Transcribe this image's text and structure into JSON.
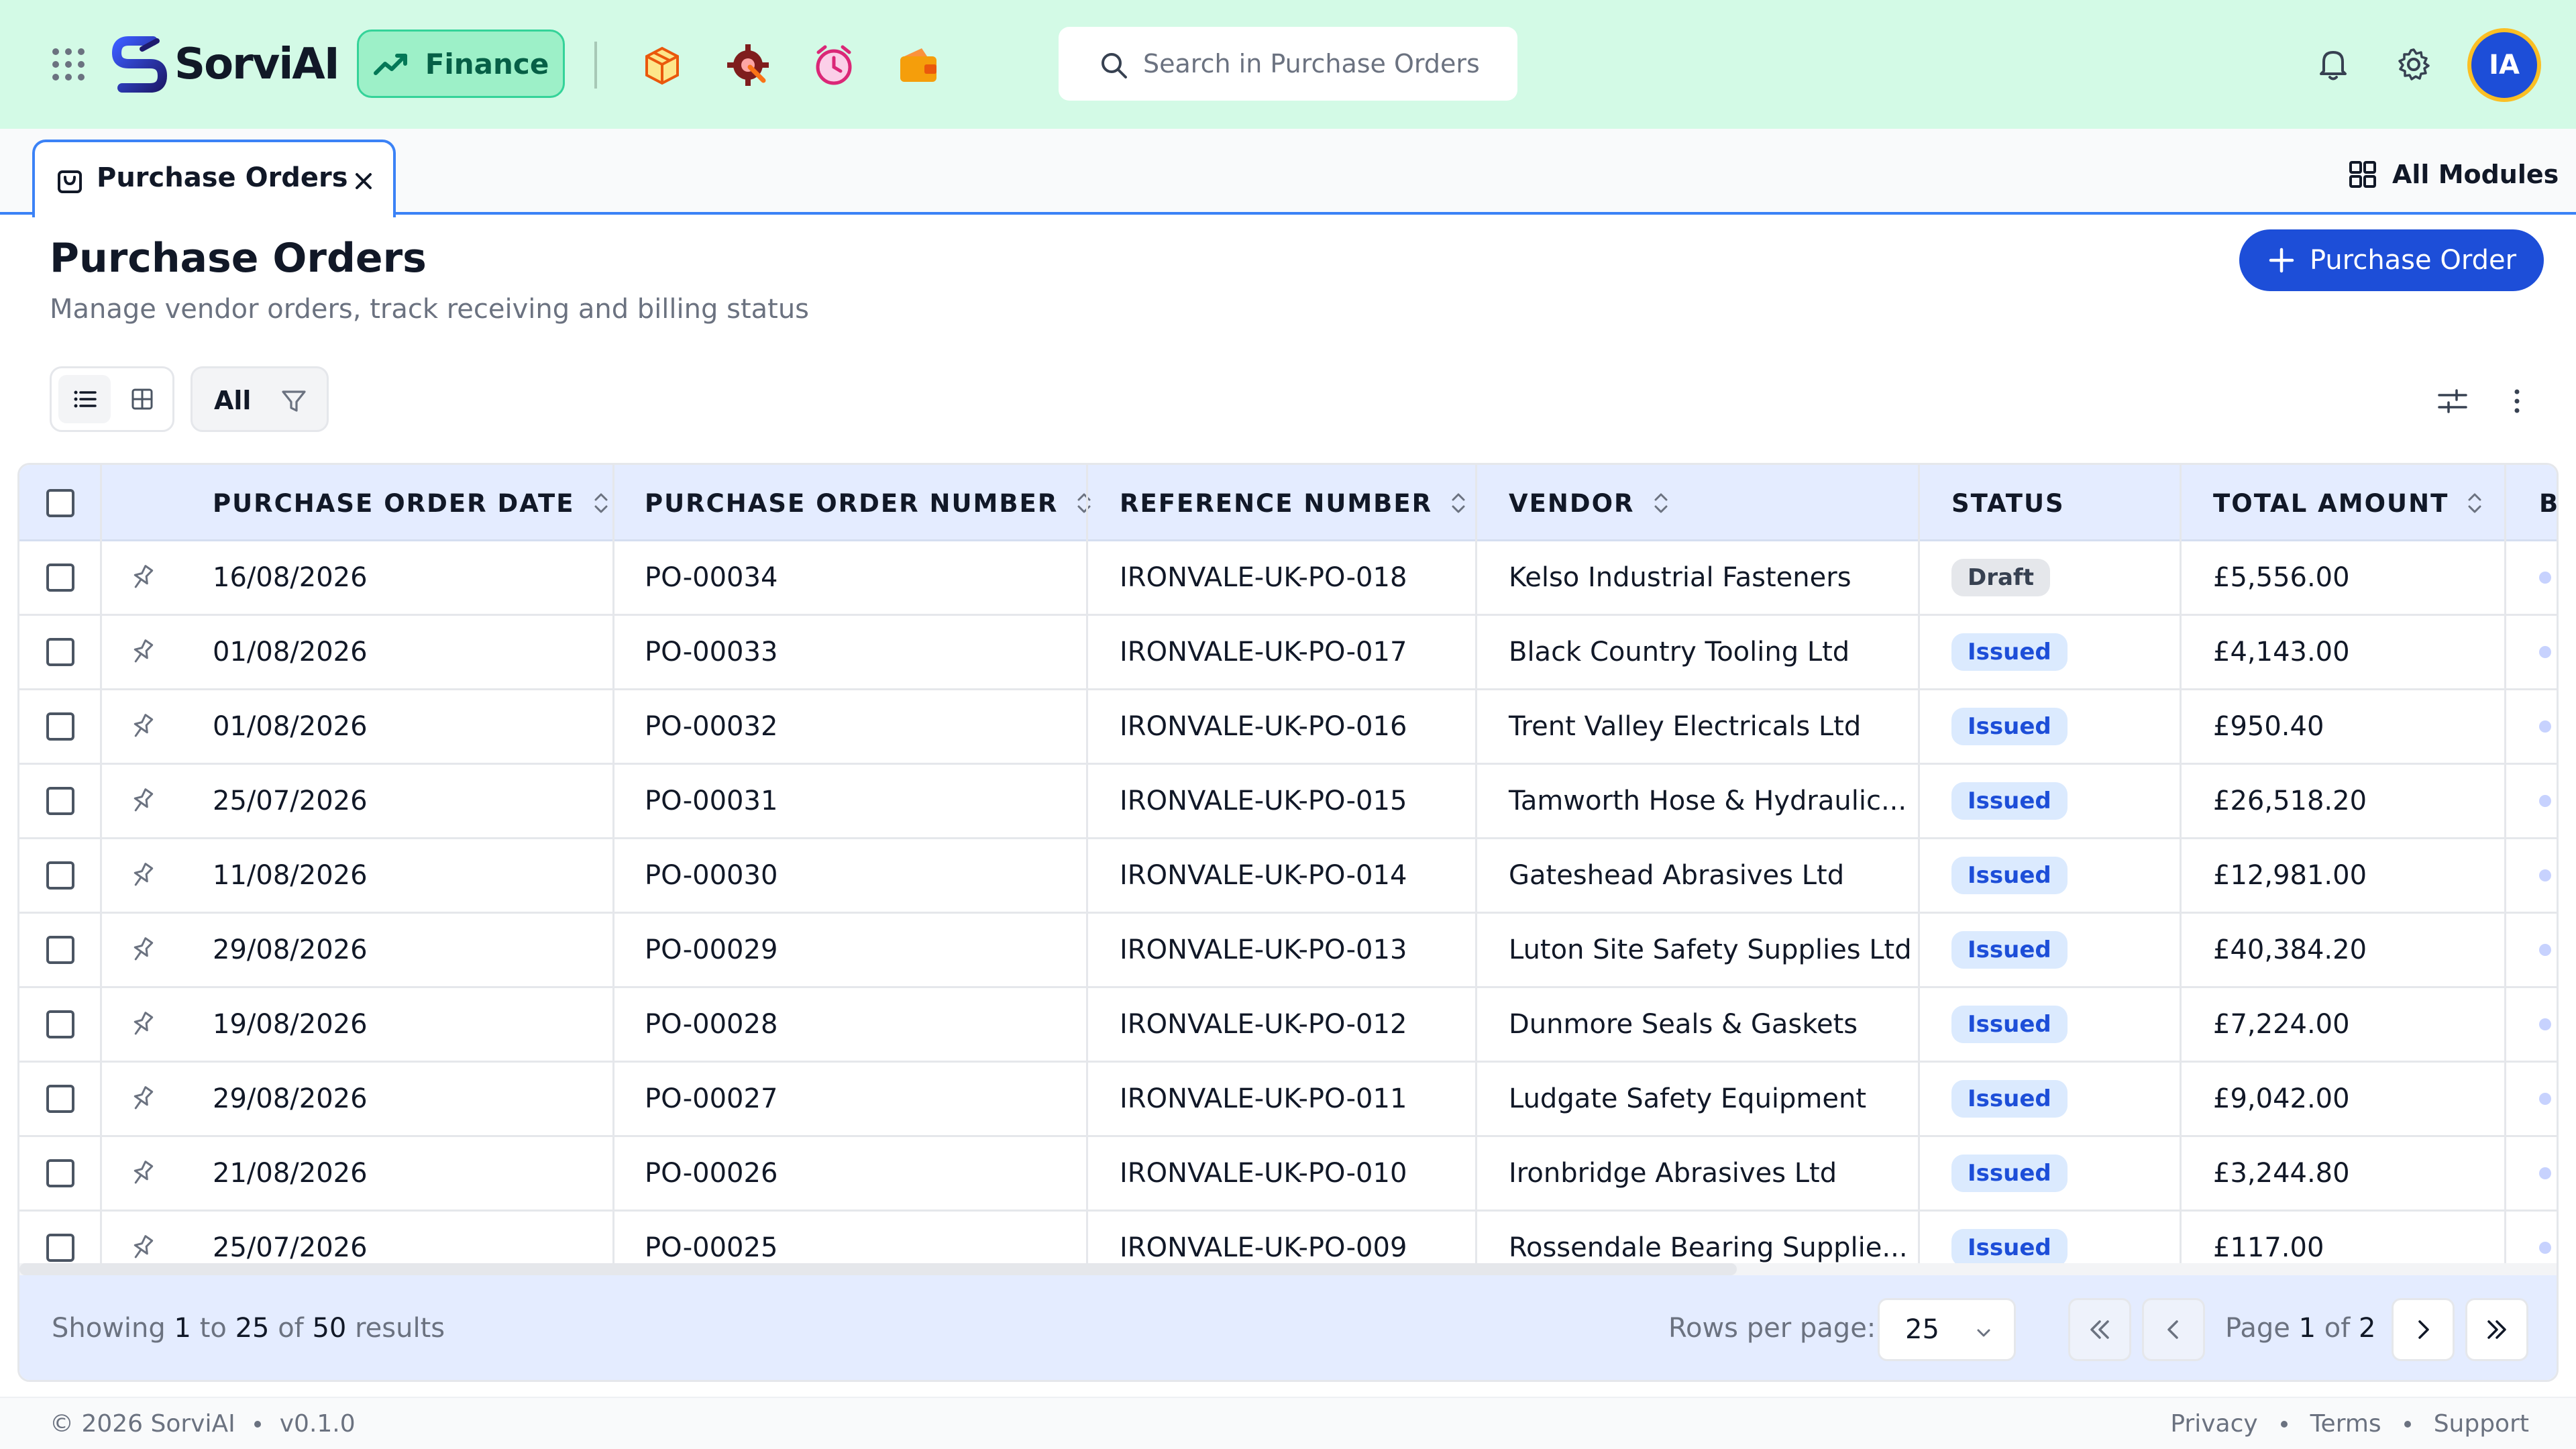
{
  "brand": {
    "name": "SorviAI"
  },
  "module": {
    "label": "Finance"
  },
  "search": {
    "placeholder": "Search in Purchase Orders"
  },
  "user": {
    "initials": "IA"
  },
  "tabs": [
    {
      "label": "Purchase Orders"
    }
  ],
  "all_modules": {
    "label": "All Modules"
  },
  "page": {
    "title": "Purchase Orders",
    "subtitle": "Manage vendor orders, track receiving and billing status",
    "new_button_label": "Purchase Order"
  },
  "toolbar": {
    "filter_label": "All"
  },
  "table": {
    "columns": [
      "PURCHASE ORDER DATE",
      "PURCHASE ORDER NUMBER",
      "REFERENCE NUMBER",
      "VENDOR",
      "STATUS",
      "TOTAL AMOUNT",
      "BI"
    ],
    "rows": [
      {
        "date": "16/08/2026",
        "number": "PO-00034",
        "reference": "IRONVALE-UK-PO-018",
        "vendor": "Kelso Industrial Fasteners",
        "status": "Draft",
        "amount": "£5,556.00"
      },
      {
        "date": "01/08/2026",
        "number": "PO-00033",
        "reference": "IRONVALE-UK-PO-017",
        "vendor": "Black Country Tooling Ltd",
        "status": "Issued",
        "amount": "£4,143.00"
      },
      {
        "date": "01/08/2026",
        "number": "PO-00032",
        "reference": "IRONVALE-UK-PO-016",
        "vendor": "Trent Valley Electricals Ltd",
        "status": "Issued",
        "amount": "£950.40"
      },
      {
        "date": "25/07/2026",
        "number": "PO-00031",
        "reference": "IRONVALE-UK-PO-015",
        "vendor": "Tamworth Hose & Hydraulic...",
        "status": "Issued",
        "amount": "£26,518.20"
      },
      {
        "date": "11/08/2026",
        "number": "PO-00030",
        "reference": "IRONVALE-UK-PO-014",
        "vendor": "Gateshead Abrasives Ltd",
        "status": "Issued",
        "amount": "£12,981.00"
      },
      {
        "date": "29/08/2026",
        "number": "PO-00029",
        "reference": "IRONVALE-UK-PO-013",
        "vendor": "Luton Site Safety Supplies Ltd",
        "status": "Issued",
        "amount": "£40,384.20"
      },
      {
        "date": "19/08/2026",
        "number": "PO-00028",
        "reference": "IRONVALE-UK-PO-012",
        "vendor": "Dunmore Seals & Gaskets",
        "status": "Issued",
        "amount": "£7,224.00"
      },
      {
        "date": "29/08/2026",
        "number": "PO-00027",
        "reference": "IRONVALE-UK-PO-011",
        "vendor": "Ludgate Safety Equipment",
        "status": "Issued",
        "amount": "£9,042.00"
      },
      {
        "date": "21/08/2026",
        "number": "PO-00026",
        "reference": "IRONVALE-UK-PO-010",
        "vendor": "Ironbridge Abrasives Ltd",
        "status": "Issued",
        "amount": "£3,244.80"
      },
      {
        "date": "25/07/2026",
        "number": "PO-00025",
        "reference": "IRONVALE-UK-PO-009",
        "vendor": "Rossendale Bearing Supplie...",
        "status": "Issued",
        "amount": "£117.00"
      }
    ]
  },
  "pagination": {
    "showing_prefix": "Showing",
    "from": "1",
    "to_word": "to",
    "to": "25",
    "of_word": "of",
    "total": "50",
    "results_word": "results",
    "rows_per_page_label": "Rows per page:",
    "rows_per_page": "25",
    "page_word": "Page",
    "current_page": "1",
    "total_pages": "2"
  },
  "footer": {
    "copyright": "© 2026 SorviAI",
    "version": "v0.1.0",
    "links": [
      "Privacy",
      "Terms",
      "Support"
    ]
  },
  "colors": {
    "topbar_bg": "#d3fae6",
    "accent": "#1d4ed8",
    "table_header_bg": "#e4ecff",
    "issued_badge": "#dbeafe",
    "draft_badge": "#e5e7eb"
  }
}
